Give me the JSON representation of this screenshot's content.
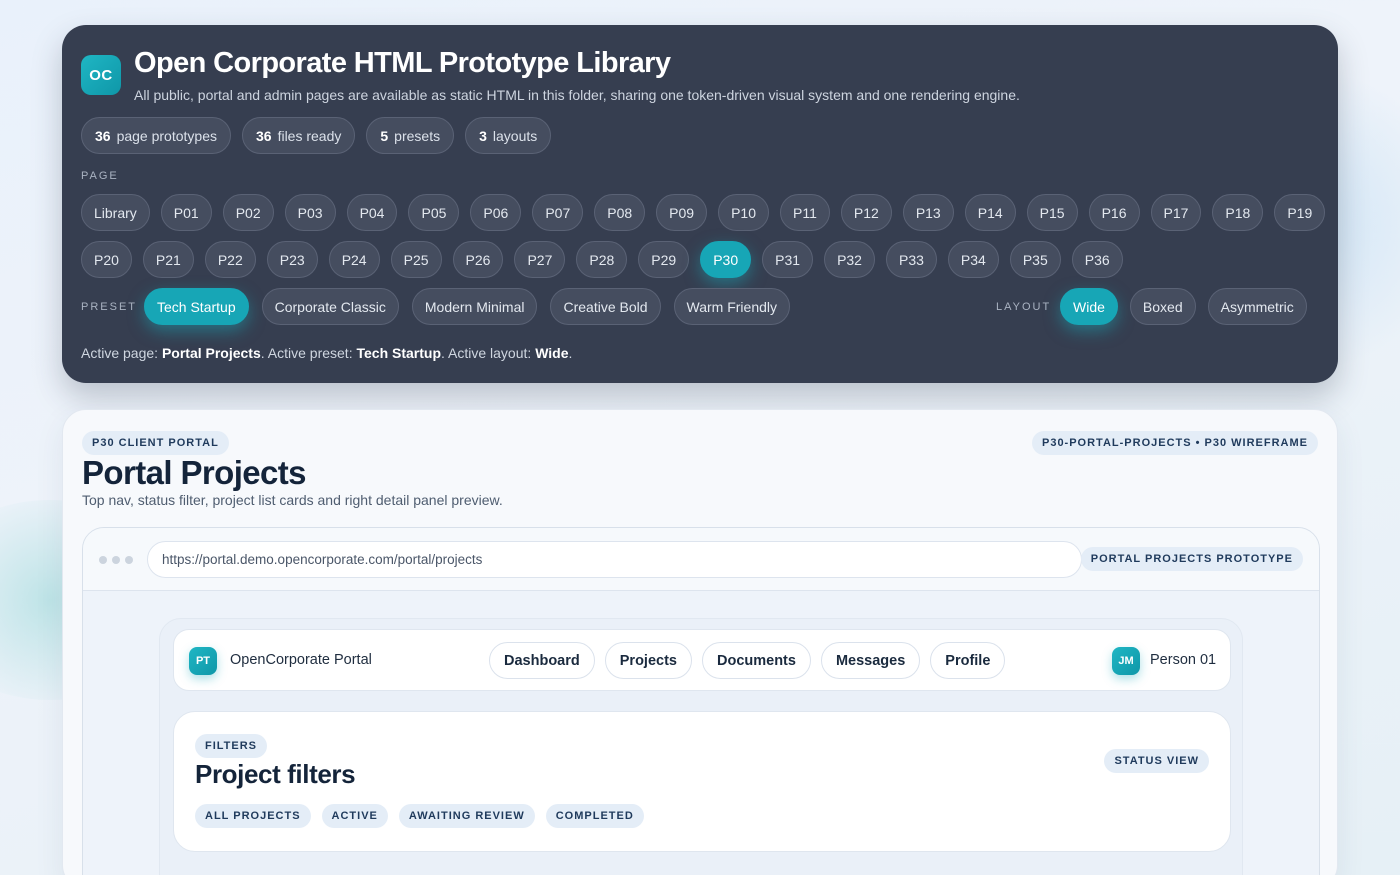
{
  "library": {
    "logo": "OC",
    "title": "Open Corporate HTML Prototype Library",
    "subtitle": "All public, portal and admin pages are available as static HTML in this folder, sharing one token-driven visual system and one rendering engine.",
    "stats": [
      {
        "num": "36",
        "label": "page prototypes"
      },
      {
        "num": "36",
        "label": "files ready"
      },
      {
        "num": "5",
        "label": "presets"
      },
      {
        "num": "3",
        "label": "layouts"
      }
    ],
    "page_label": "PAGE",
    "pages_row1": [
      "Library",
      "P01",
      "P02",
      "P03",
      "P04",
      "P05",
      "P06",
      "P07",
      "P08",
      "P09",
      "P10",
      "P11",
      "P12",
      "P13",
      "P14",
      "P15",
      "P16",
      "P17",
      "P18",
      "P19"
    ],
    "pages_row2": [
      "P20",
      "P21",
      "P22",
      "P23",
      "P24",
      "P25",
      "P26",
      "P27",
      "P28",
      "P29",
      "P30",
      "P31",
      "P32",
      "P33",
      "P34",
      "P35",
      "P36"
    ],
    "active_page": "P30",
    "preset_label": "PRESET",
    "presets": [
      "Tech Startup",
      "Corporate Classic",
      "Modern Minimal",
      "Creative Bold",
      "Warm Friendly"
    ],
    "active_preset": "Tech Startup",
    "layout_label": "LAYOUT",
    "layouts": [
      "Wide",
      "Boxed",
      "Asymmetric"
    ],
    "active_layout": "Wide",
    "status": {
      "p1": "Active page: ",
      "page": "Portal Projects",
      "p2": ". Active preset: ",
      "preset": "Tech Startup",
      "p3": ". Active layout: ",
      "layout": "Wide",
      "p4": "."
    }
  },
  "preview": {
    "tag": "P30 CLIENT PORTAL",
    "id_tag": "P30-PORTAL-PROJECTS • P30 WIREFRAME",
    "title": "Portal Projects",
    "subtitle": "Top nav, status filter, project list cards and right detail panel preview.",
    "url": "https://portal.demo.opencorporate.com/portal/projects",
    "prototype_tag": "PORTAL PROJECTS PROTOTYPE",
    "topnav": {
      "logo": "PT",
      "brand": "OpenCorporate Portal",
      "tabs": [
        "Dashboard",
        "Projects",
        "Documents",
        "Messages",
        "Profile"
      ],
      "avatar": "JM",
      "user": "Person 01"
    },
    "filters": {
      "tag": "FILTERS",
      "title": "Project filters",
      "status_view": "STATUS VIEW",
      "options": [
        "ALL PROJECTS",
        "ACTIVE",
        "AWAITING REVIEW",
        "COMPLETED"
      ]
    }
  },
  "colors": {
    "accent": "#17a6b6",
    "panel_dark": "#363e50",
    "chip_dark": "#454d5f"
  }
}
